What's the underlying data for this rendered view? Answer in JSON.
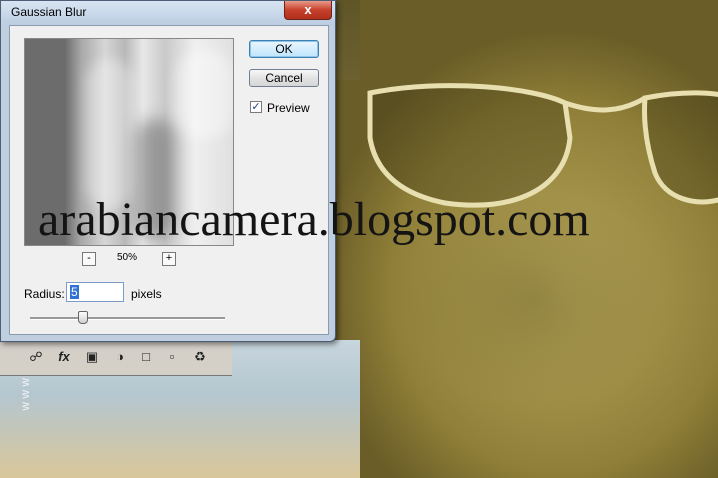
{
  "dialog": {
    "title": "Gaussian Blur",
    "close_label": "x",
    "ok_label": "OK",
    "cancel_label": "Cancel",
    "preview_label": "Preview",
    "preview_checked": true,
    "zoom": "50%",
    "zoom_out": "-",
    "zoom_in": "+",
    "radius_label": "Radius:",
    "radius_value": "5",
    "radius_unit": "pixels",
    "radius_slider_fraction": 0.25
  },
  "watermark": {
    "text": "arabiancamera.blogspot.com",
    "vertical_text": "w w w"
  },
  "layers_panel": {
    "icons": [
      "link-icon",
      "fx-icon",
      "mask-icon",
      "adjustment-icon",
      "folder-icon",
      "new-layer-icon",
      "trash-icon"
    ]
  }
}
